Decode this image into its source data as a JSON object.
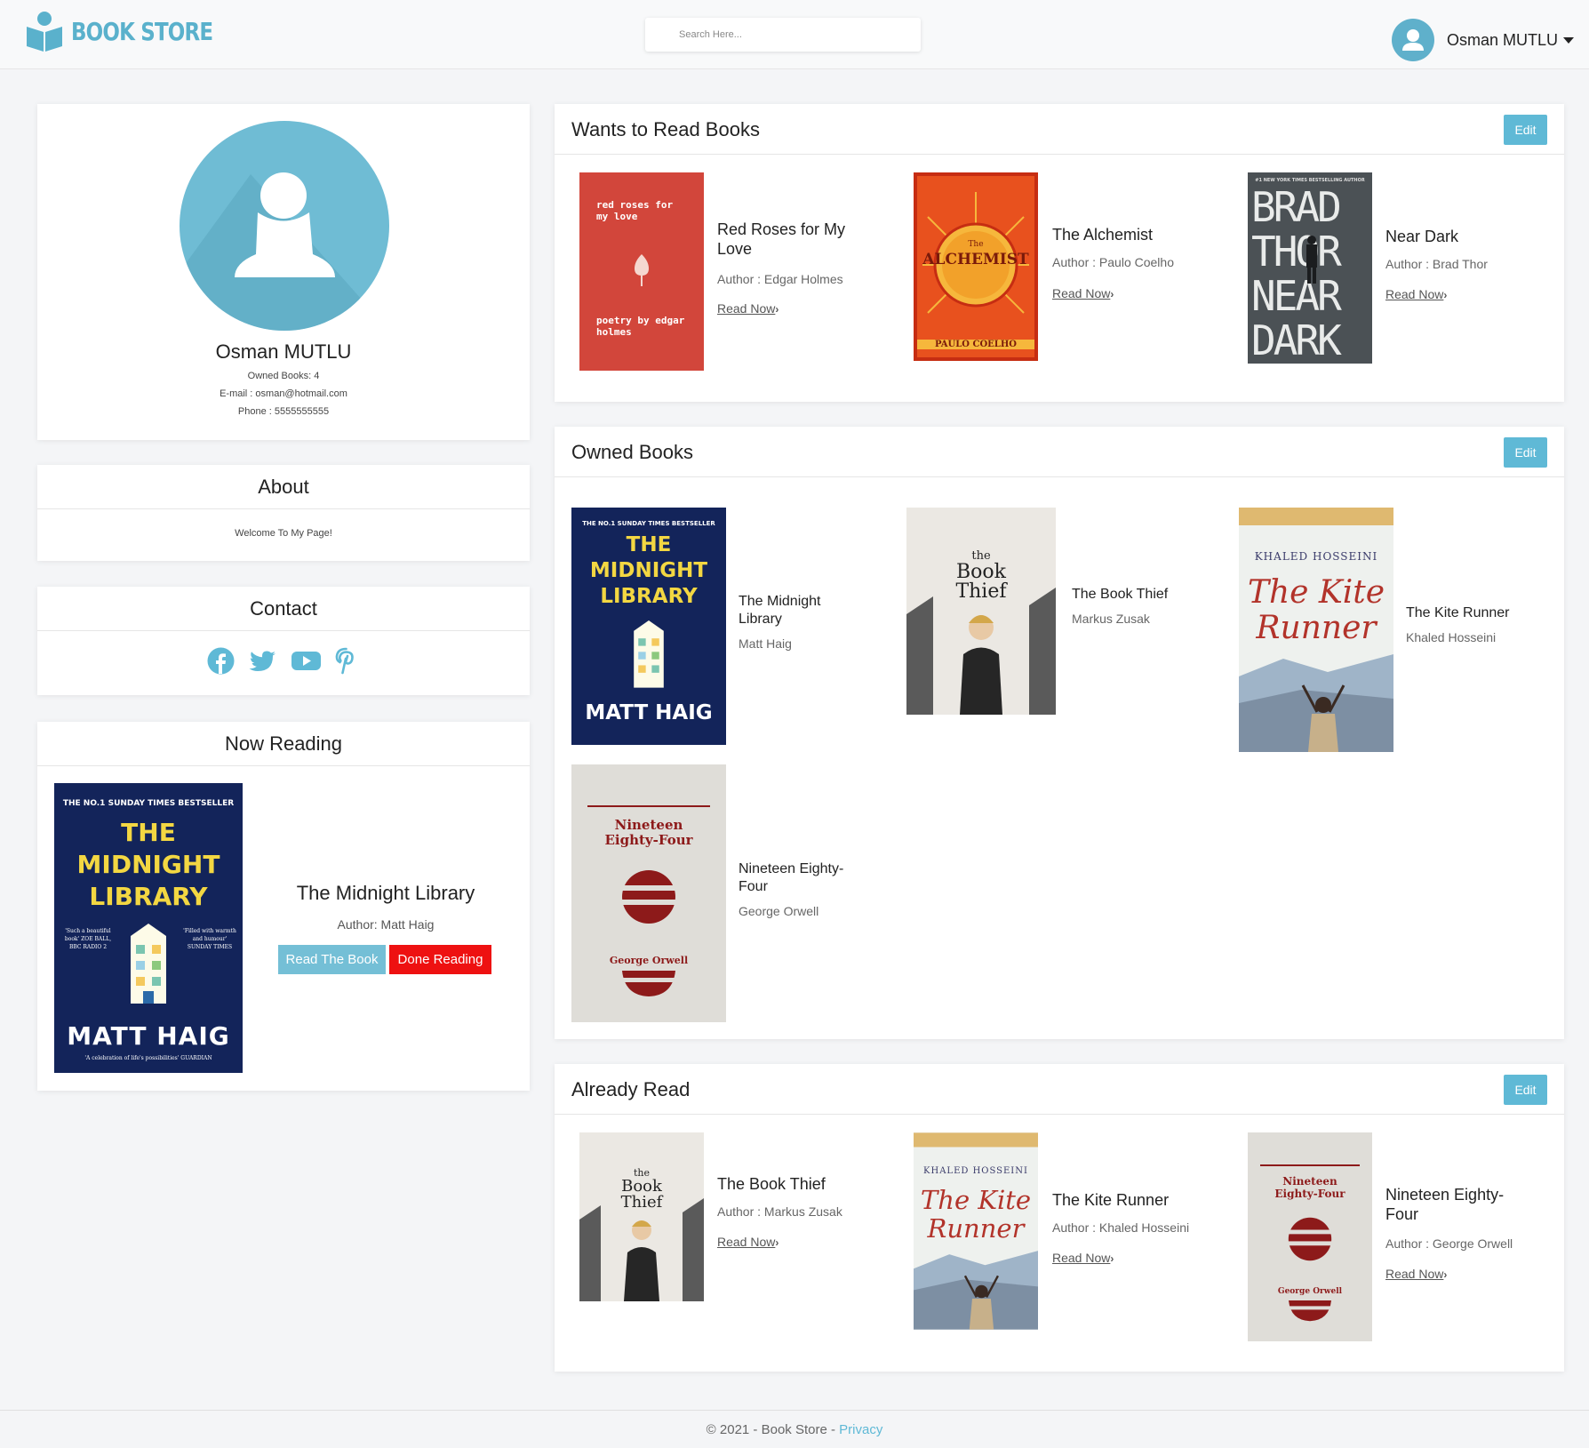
{
  "header": {
    "logo_text": "BOOK STORE",
    "search_placeholder": "Search Here...",
    "user_name": "Osman MUTLU"
  },
  "profile": {
    "name": "Osman MUTLU",
    "owned_books": "Owned Books: 4",
    "email": "E-mail : osman@hotmail.com",
    "phone": "Phone : 5555555555"
  },
  "about": {
    "title": "About",
    "text": "Welcome To My Page!"
  },
  "contact": {
    "title": "Contact",
    "icons": [
      "facebook-icon",
      "twitter-icon",
      "youtube-icon",
      "pinterest-icon"
    ]
  },
  "now_reading": {
    "title": "Now Reading",
    "book_title": "The Midnight Library",
    "author": "Author: Matt Haig",
    "read_button": "Read The Book",
    "done_button": "Done Reading",
    "cover": {
      "top": "THE NO.1 SUNDAY TIMES BESTSELLER",
      "title_lines": [
        "THE",
        "MIDNIGHT",
        "LIBRARY"
      ],
      "quote_left": "'Such a beautiful book' ZOE BALL, BBC RADIO 2",
      "quote_right": "'Filled with warmth and humour' SUNDAY TIMES",
      "author": "MATT HAIG",
      "tagline": "'A celebration of life's possibilities' GUARDIAN"
    }
  },
  "wants_to_read": {
    "title": "Wants to Read Books",
    "edit": "Edit",
    "books": [
      {
        "title": "Red Roses for My Love",
        "author": "Author : Edgar Holmes",
        "read_now": "Read Now",
        "cover_top": "red roses for my love",
        "cover_bottom": "poetry by edgar holmes"
      },
      {
        "title": "The Alchemist",
        "author": "Author : Paulo Coelho",
        "read_now": "Read Now",
        "cover_small": "The",
        "cover_title": "ALCHEMIST",
        "cover_author": "PAULO COELHO"
      },
      {
        "title": "Near Dark",
        "author": "Author : Brad Thor",
        "read_now": "Read Now",
        "cover_top": "#1 NEW YORK TIMES BESTSELLING AUTHOR",
        "cover_lines": [
          "BRAD",
          "THOR",
          "NEAR",
          "DARK"
        ]
      }
    ]
  },
  "owned_books": {
    "title": "Owned Books",
    "edit": "Edit",
    "books": [
      {
        "title": "The Midnight Library",
        "author": "Matt Haig"
      },
      {
        "title": "The Book Thief",
        "author": "Markus Zusak"
      },
      {
        "title": "The Kite Runner",
        "author": "Khaled Hosseini"
      },
      {
        "title": "Nineteen Eighty-Four",
        "author": "George Orwell"
      }
    ]
  },
  "already_read": {
    "title": "Already Read",
    "edit": "Edit",
    "books": [
      {
        "title": "The Book Thief",
        "author": "Author : Markus Zusak",
        "read_now": "Read Now"
      },
      {
        "title": "The Kite Runner",
        "author": "Author : Khaled Hosseini",
        "read_now": "Read Now"
      },
      {
        "title": "Nineteen Eighty-Four",
        "author": "Author : George Orwell",
        "read_now": "Read Now"
      }
    ]
  },
  "covers": {
    "book_thief": {
      "the": "the",
      "book": "Book",
      "thief": "Thief"
    },
    "kite_runner": {
      "author": "KHALED HOSSEINI",
      "title_1": "The Kite",
      "title_2": "Runner"
    },
    "nineteen": {
      "title_1": "Nineteen",
      "title_2": "Eighty-Four",
      "author": "George Orwell"
    }
  },
  "footer": {
    "copyright": "© 2021 - Book Store - ",
    "privacy": "Privacy"
  },
  "colors": {
    "accent": "#5fb9d6",
    "done_red": "#ee1111",
    "midnight_blue": "#13245a",
    "roses_red": "#d2463b",
    "alchemist_orange": "#e8511e"
  }
}
